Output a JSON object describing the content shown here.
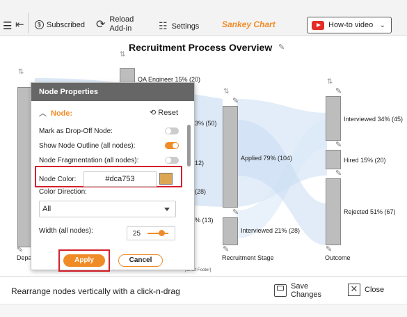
{
  "toolbar": {
    "subscribed_label": "Subscribed",
    "reload_label_1": "Reload",
    "reload_label_2": "Add-in",
    "settings_label": "Settings",
    "app_title": "Sankey Chart",
    "howto_label": "How-to video"
  },
  "chart": {
    "title": "Recruitment Process Overview",
    "footer": "[Chart Footer]",
    "labels": {
      "left_stage": "Depa",
      "qa": "QA Engineer 15% (20)",
      "partial_a": "3% (50)",
      "partial_b": "12)",
      "partial_c": "(28)",
      "partial_d": "% (13)",
      "applied": "Applied 79% (104)",
      "interviewed_mid": "Interviewed 21% (28)",
      "recruitment_stage": "Recruitment Stage",
      "interviewed_out": "Interviewed 34% (45)",
      "hired": "Hired 15% (20)",
      "rejected": "Rejected 51% (67)",
      "outcome": "Outcome"
    },
    "colors": {
      "node_fill": "#bdbdbd",
      "flow": "#c9dcf2"
    }
  },
  "modal": {
    "title": "Node Properties",
    "section": "Node:",
    "reset_label": "Reset",
    "mark_dropoff_label": "Mark as Drop-Off Node:",
    "mark_dropoff_on": false,
    "outline_label": "Show Node Outline (all nodes):",
    "outline_on": true,
    "fragmentation_label": "Node Fragmentation (all nodes):",
    "fragmentation_on": false,
    "node_color_label": "Node Color:",
    "node_color_value": "#dca753",
    "color_direction_label": "Color Direction:",
    "color_direction_value": "All",
    "width_label": "Width (all nodes):",
    "width_value": "25",
    "apply_label": "Apply",
    "cancel_label": "Cancel"
  },
  "footer": {
    "hint": "Rearrange nodes vertically with a click-n-drag",
    "save_label_1": "Save",
    "save_label_2": "Changes",
    "close_label": "Close"
  },
  "colors": {
    "accent": "#f08c28",
    "highlight": "#d3212c",
    "header": "#666666"
  }
}
